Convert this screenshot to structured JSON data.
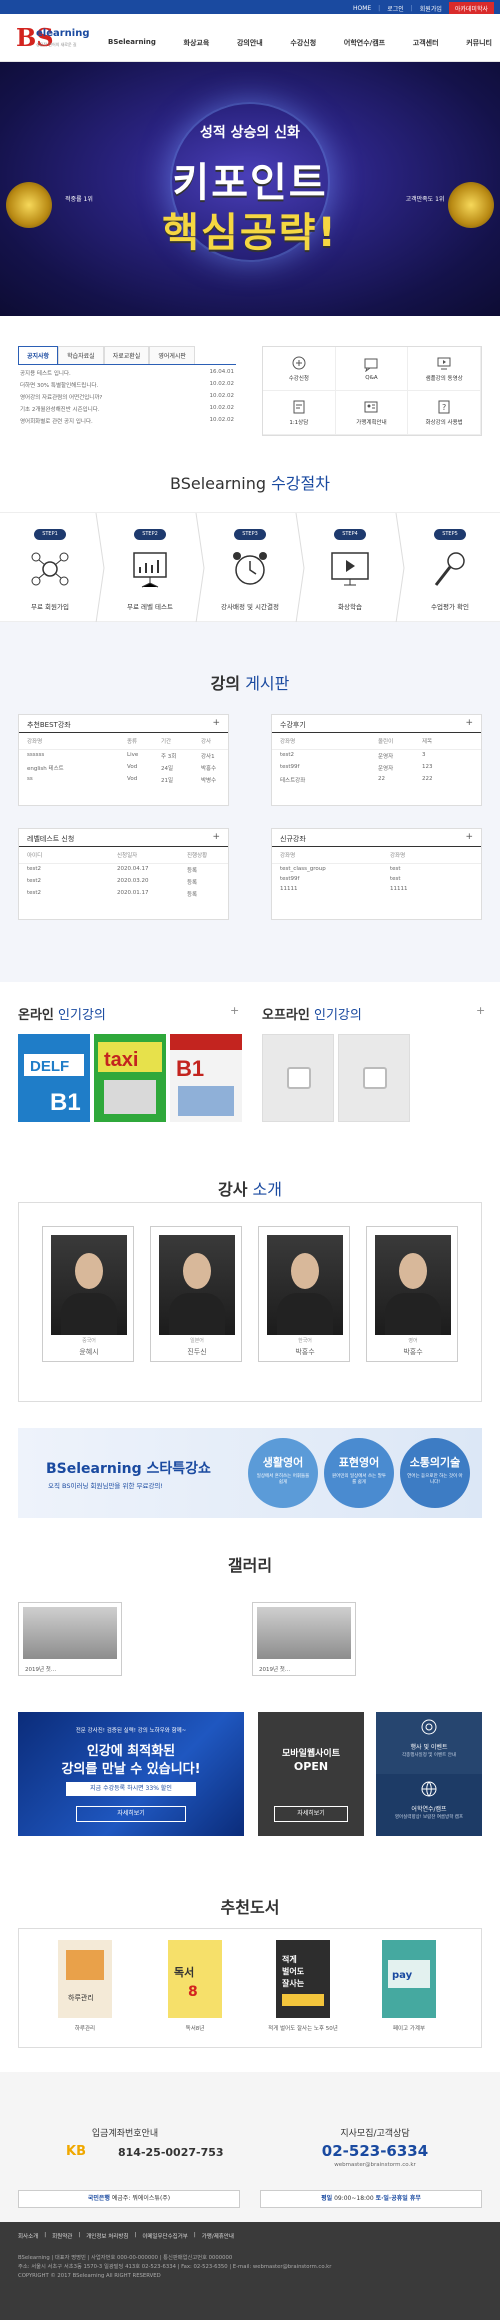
{
  "topbar": {
    "home": "HOME",
    "login": "로그인",
    "join": "회원가입",
    "academy": "아카데미학사"
  },
  "logo": {
    "brand": "BS",
    "name": "elearning",
    "tagline": "성공적 언어의 새로운 길"
  },
  "nav": [
    "BSelearning",
    "화상교육",
    "강의안내",
    "수강신청",
    "어학연수/캠프",
    "고객센터",
    "커뮤니티"
  ],
  "banner": {
    "subtitle": "성적 상승의 신화",
    "title1": "키포인트",
    "title2": "핵심공략!",
    "badge_left": "적중률 1위",
    "badge_right": "고객만족도 1위"
  },
  "notice": {
    "tabs": [
      "공지사항",
      "학습자료실",
      "자료교환실",
      "영어게시판"
    ],
    "rows": [
      {
        "t": "공지용 테스트 입니다.",
        "d": "16.04.01"
      },
      {
        "t": "더하면 30% 특별할인해드립니다.",
        "d": "10.02.02"
      },
      {
        "t": "영어강의 자료관렴의 어떤건입니까?",
        "d": "10.02.02"
      },
      {
        "t": "기초 2개월완성해진반 시즌입니다.",
        "d": "10.02.02"
      },
      {
        "t": "영어회화별로 관련 공지 입니다.",
        "d": "10.02.02"
      }
    ]
  },
  "quick": [
    {
      "label": "수강신청",
      "icon": "monitor-icon"
    },
    {
      "label": "Q&A",
      "icon": "qna-icon"
    },
    {
      "label": "샘플강의 동영상",
      "icon": "video-icon"
    },
    {
      "label": "1:1상담",
      "icon": "chat-icon"
    },
    {
      "label": "가맹계획안내",
      "icon": "doc-icon"
    },
    {
      "label": "화상강의 사용법",
      "icon": "help-icon"
    }
  ],
  "process": {
    "title_a": "BSelearning",
    "title_b": "수강절차",
    "steps": [
      {
        "pill": "STEP1",
        "label": "무료 회원가입",
        "icon": "network-icon"
      },
      {
        "pill": "STEP2",
        "label": "무료 레벨 테스트",
        "icon": "chart-board-icon"
      },
      {
        "pill": "STEP3",
        "label": "강사배정 및 시간결정",
        "icon": "alarm-clock-icon"
      },
      {
        "pill": "STEP4",
        "label": "화상학습",
        "icon": "video-lesson-icon"
      },
      {
        "pill": "STEP5",
        "label": "수업평가 확인",
        "icon": "microphone-icon"
      }
    ]
  },
  "boards": {
    "title_a": "강의",
    "title_b": "게시판",
    "best": {
      "title": "추천BEST강좌",
      "cols": [
        "강좌명",
        "종류",
        "기간",
        "강사"
      ],
      "rows": [
        [
          "ssssss",
          "Live",
          "주 3회",
          "강사1"
        ],
        [
          "english 테스트",
          "Vod",
          "24일",
          "박홍수"
        ],
        [
          "ss",
          "Vod",
          "21일",
          "박병수"
        ]
      ]
    },
    "review": {
      "title": "수강후기",
      "cols": [
        "강좌명",
        "올린이",
        "제목"
      ],
      "rows": [
        [
          "test2",
          "운영자",
          "3"
        ],
        [
          "test99f",
          "운영자",
          "123"
        ],
        [
          "테스트강좌",
          "22",
          "222"
        ]
      ]
    },
    "level": {
      "title": "레벨테스트 신청",
      "cols": [
        "아이디",
        "신청일자",
        "진행상황"
      ],
      "rows": [
        [
          "test2",
          "2020.04.17",
          "등록"
        ],
        [
          "test2",
          "2020.03.20",
          "등록"
        ],
        [
          "test2",
          "2020.01.17",
          "등록"
        ]
      ]
    },
    "newc": {
      "title": "신규강좌",
      "cols": [
        "강좌명",
        "강좌명"
      ],
      "rows": [
        [
          "test_class_group",
          "test"
        ],
        [
          "test99f",
          "test"
        ],
        [
          "11111",
          "11111"
        ]
      ]
    }
  },
  "popular": {
    "online_a": "온라인",
    "online_b": "인기강의",
    "offline_a": "오프라인",
    "offline_b": "인기강의"
  },
  "teachers": {
    "title_a": "강사",
    "title_b": "소개",
    "list": [
      {
        "sub": "중국어",
        "name": "윤혜시"
      },
      {
        "sub": "일본어",
        "name": "진두신"
      },
      {
        "sub": "한국어",
        "name": "박홍수"
      },
      {
        "sub": "영어",
        "name": "박홍수"
      }
    ]
  },
  "promo": {
    "title": "BSelearning 스타특강쇼",
    "sub": "오직 BS이러닝 회원님만을 위한 무료강의!",
    "circles": [
      {
        "a": "생활영어",
        "b": "일상에서 흔히쓰는 어휘들을 쉽게"
      },
      {
        "a": "표현영어",
        "b": "원어민의 일상에서 쓰는 말투를 쉽게"
      },
      {
        "a": "소통의기술",
        "b": "언어는 듣으로만 하는 것이 아니다!"
      }
    ]
  },
  "gallery": {
    "title": "갤러리",
    "items": [
      "2019년 첫...",
      "2019년 첫..."
    ]
  },
  "ads": {
    "ad1_top": "전문 강사진! 검증된 실력! 강의 노하우와 함께~",
    "ad1_h1": "인강에 최적화된",
    "ad1_h2": "강의를 만날 수 있습니다!",
    "ad1_tag": "지금 수강등록 하시면 33% 할인",
    "ad1_btn": "자세히보기",
    "ad2_h1": "모바일웹사이트",
    "ad2_h2": "OPEN",
    "ad2_btn": "자세히보기",
    "ad3_t": "행사 및 이벤트",
    "ad3_s": "각종행사일정 및 이벤트 안내",
    "ad4_t": "어학연수/캠프",
    "ad4_s": "영어실력향상! 보람찬 여름방학 캠프"
  },
  "books": {
    "title": "추천도서",
    "items": [
      "하루관리",
      "독서8년",
      "적게 벌어도 잘사는 노후 50년",
      "페이고 가계부"
    ]
  },
  "bank": {
    "title": "입금계좌번호안내",
    "bank": "KB",
    "account": "814-25-0027-753",
    "holder_lbl": "국민은행",
    "holder": "예금주: 뭐에이스튜(주)"
  },
  "contact": {
    "title": "지사모집/고객상담",
    "phone": "02-523-6334",
    "email": "webmaster@brainstorm.co.kr",
    "hours_lbl": "평일",
    "hours": "09:00~18:00",
    "off": "토·일·공휴일 휴무"
  },
  "footer": {
    "links": [
      "회사소개",
      "회원약관",
      "개인정보 처리방침",
      "이메일무단수집거부",
      "가맹/제휴안내"
    ],
    "line1": "BSelearning | 대표자 명명빈 | 사업자번호 000-00-000000 | 통신판매업신고번호 0000000",
    "line2": "주소: 서울시 서초구 서초3동 1570-3 일광빌딩 413호 02-523-6334 | Fax: 02-523-6350 | E-mail: webmaster@brainstorm.co.kr",
    "line3": "COPYRIGHT © 2017 BSelearning All RIGHT RESERVED"
  },
  "colors": {
    "brand_blue": "#1a4aa0",
    "brand_red": "#d3241f"
  }
}
